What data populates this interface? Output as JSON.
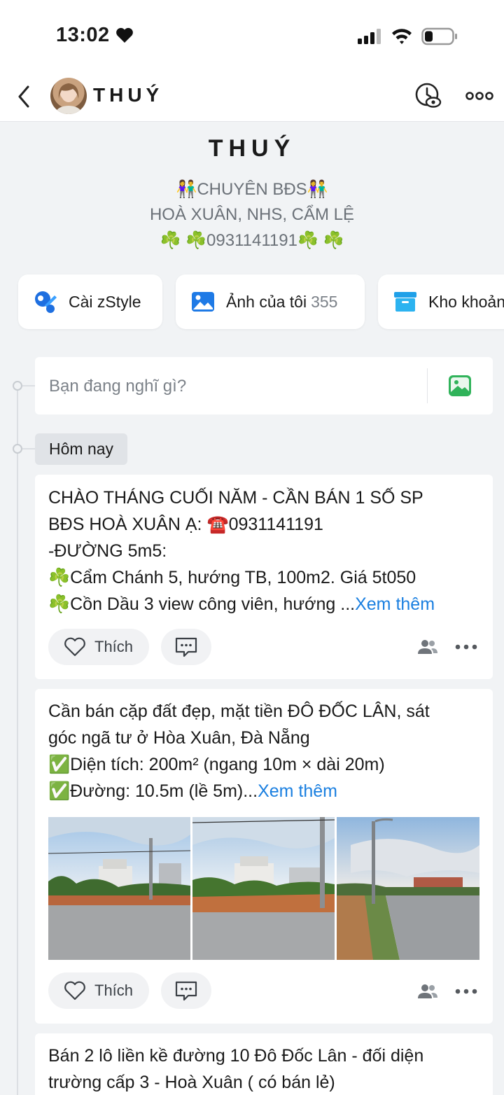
{
  "status_bar": {
    "time": "13:02"
  },
  "header": {
    "name": "THUÝ"
  },
  "profile": {
    "name": "THUÝ",
    "bio_line1": "👫CHUYÊN BĐS👫",
    "bio_line2": "HOÀ XUÂN, NHS, CẨM LỆ",
    "bio_line3": "☘️ ☘️0931141191☘️ ☘️"
  },
  "chips": [
    {
      "label": "Cài zStyle",
      "icon": "zstyle-icon"
    },
    {
      "label": "Ảnh của tôi",
      "count": "355",
      "icon": "photo-icon"
    },
    {
      "label": "Kho khoản",
      "icon": "archive-box-icon"
    }
  ],
  "composer": {
    "placeholder": "Bạn đang nghĩ gì?"
  },
  "timeline": {
    "day_label": "Hôm nay"
  },
  "posts": [
    {
      "lines": [
        "CHÀO THÁNG CUỐI NĂM - CẦN BÁN 1 SỐ SP",
        "BĐS HOÀ XUÂN Ạ: ☎️0931141191",
        "-ĐƯỜNG 5m5:",
        "☘️Cẩm Chánh 5, hướng TB, 100m2. Giá 5t050",
        "☘️Cồn Dầu 3 view công viên, hướng ..."
      ],
      "see_more": "Xem thêm",
      "like_label": "Thích"
    },
    {
      "lines": [
        "Cần bán cặp đất đẹp, mặt tiền ĐÔ ĐỐC LÂN, sát",
        "góc ngã tư ở Hòa Xuân, Đà Nẵng",
        " ✅Diện tích: 200m² (ngang 10m × dài 20m)",
        " ✅Đường: 10.5m (lề 5m)..."
      ],
      "see_more": "Xem thêm",
      "like_label": "Thích",
      "photo_count": 3
    },
    {
      "lines": [
        "Bán 2 lô liền kề đường 10 Đô Đốc Lân - đối diện",
        "trường cấp 3 - Hoà Xuân ( có bán lẻ)"
      ]
    }
  ],
  "colors": {
    "accent": "#1a7fe0",
    "background": "#f1f3f5",
    "card": "#ffffff"
  }
}
